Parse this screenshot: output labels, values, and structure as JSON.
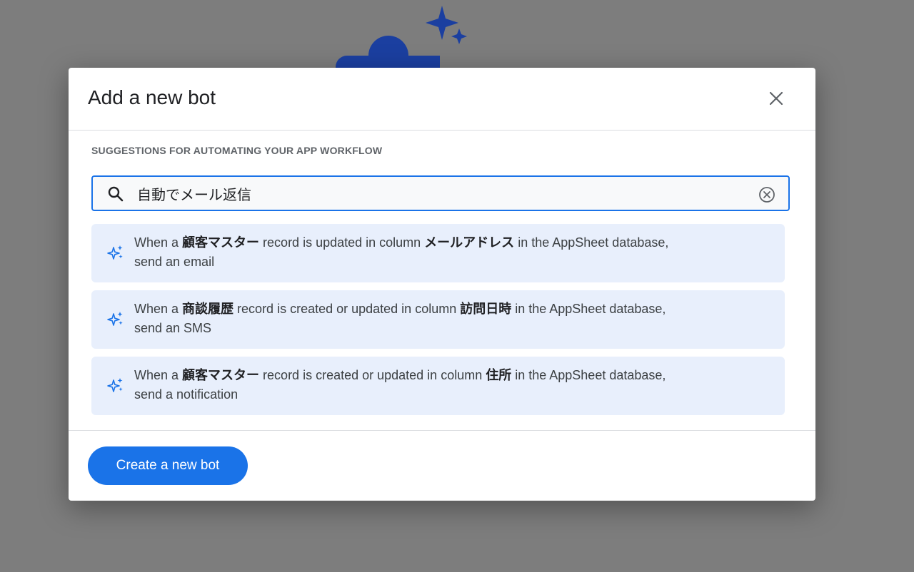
{
  "dialog": {
    "title": "Add a new bot",
    "section_label": "SUGGESTIONS FOR AUTOMATING YOUR APP WORKFLOW",
    "search": {
      "value": "自動でメール返信",
      "icon": "search-icon",
      "clear_icon": "clear-circle-icon"
    },
    "suggestions": [
      {
        "icon": "sparkle-icon",
        "p1": "When a ",
        "table": "顧客マスター",
        "p2": " record is updated in column ",
        "column": "メールアドレス",
        "p3": " in the AppSheet database,",
        "action": "send an email"
      },
      {
        "icon": "sparkle-icon",
        "p1": "When a ",
        "table": "商談履歴",
        "p2": " record is created or updated in column ",
        "column": "訪問日時",
        "p3": " in the AppSheet database,",
        "action": "send an SMS"
      },
      {
        "icon": "sparkle-icon",
        "p1": "When a ",
        "table": "顧客マスター",
        "p2": " record is created or updated in column ",
        "column": "住所",
        "p3": " in the AppSheet database,",
        "action": "send a notification"
      }
    ],
    "create_button": "Create a new bot"
  },
  "colors": {
    "accent": "#1a73e8",
    "suggestion_bg": "#e8effc",
    "overlay": "#7d7d7d",
    "illustration": "#1b3fa0"
  }
}
